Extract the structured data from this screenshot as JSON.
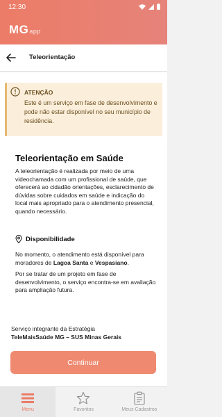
{
  "status_bar": {
    "time": "12:30"
  },
  "app": {
    "logo": "MG",
    "logo_sub": "app"
  },
  "page": {
    "title": "Teleorientação"
  },
  "alert": {
    "title": "ATENÇÃO",
    "text": "Este é um serviço em fase de desenvolvimento e pode não estar disponível no seu município de residência."
  },
  "main": {
    "title": "Teleorientação em Saúde",
    "intro": "A teleorientação é realizada por meio de uma videochamada com um profissional de saúde, que oferecerá ao cidadão orientações, esclarecimento de dúvidas sobre cuidados em saúde e indicação do local mais apropriado para o atendimento presencial, quando necessário."
  },
  "availability": {
    "title": "Disponibilidade",
    "text_prefix": "No momento, o atendimento está disponível para moradores de ",
    "city1": "Lagoa Santa",
    "conj": " e ",
    "city2": "Vespasiano",
    "text_suffix": ".",
    "project_text": "Por se tratar de um projeto em fase de desenvolvimento, o serviço encontra-se em avaliação para ampliação futura."
  },
  "footer": {
    "line1": "Serviço integrante da Estratégia",
    "line2": "TeleMaisSaúde MG – SUS Minas Gerais"
  },
  "continue_label": "Continuar",
  "nav": {
    "menu": "Menu",
    "favorites": "Favoritos",
    "registrations": "Meus Cadastros"
  },
  "colors": {
    "header": "#ec7c67",
    "button": "#ef8a71",
    "alert_bg": "#fbefdc",
    "alert_accent": "#e2b96e"
  }
}
